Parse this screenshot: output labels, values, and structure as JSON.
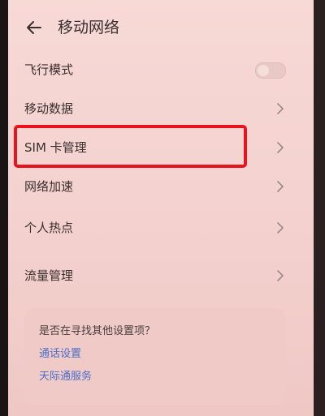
{
  "header": {
    "title": "移动网络",
    "back_icon": "back-arrow-icon"
  },
  "settings": {
    "airplane_mode": {
      "label": "飞行模式",
      "enabled": false
    },
    "mobile_data": {
      "label": "移动数据"
    },
    "sim_management": {
      "label": "SIM 卡管理"
    },
    "network_acceleration": {
      "label": "网络加速"
    },
    "personal_hotspot": {
      "label": "个人热点"
    },
    "data_usage": {
      "label": "流量管理"
    }
  },
  "suggestions": {
    "title": "是否在寻找其他设置项？",
    "links": [
      "通话设置",
      "天际通服务"
    ]
  },
  "colors": {
    "highlight": "#e8131c",
    "link": "#4b6ec9"
  }
}
